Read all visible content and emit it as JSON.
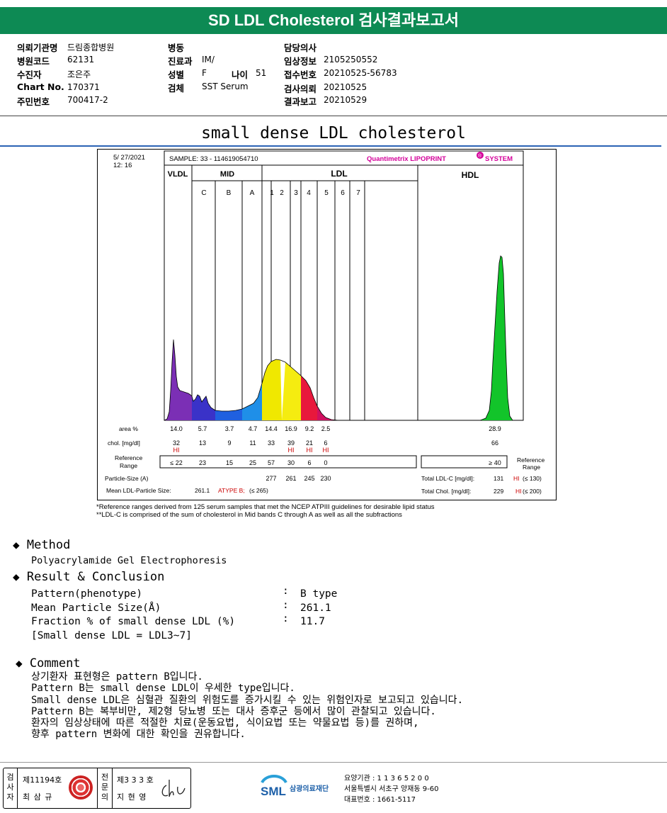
{
  "header": {
    "title": "SD LDL Cholesterol 검사결과보고서"
  },
  "info": {
    "hospital_label": "의뢰기관명",
    "hospital": "드림종합병원",
    "code_label": "병원코드",
    "code": "62131",
    "patient_label": "수진자",
    "patient": "조은주",
    "chart_label": "Chart No.",
    "chart": "170371",
    "id_label": "주민번호",
    "id": "700417-2",
    "ward_label": "병동",
    "ward": "",
    "dept_label": "진료과",
    "dept": "IM/",
    "sex_label": "성별",
    "sex": "F",
    "age_label": "나이",
    "age": "51",
    "specimen_label": "검체",
    "specimen": "SST Serum",
    "doctor_label": "담당의사",
    "doctor": "",
    "clinical_label": "임상정보",
    "clinical": "2105250552",
    "receipt_label": "접수번호",
    "receipt": "20210525-56783",
    "request_label": "검사의뢰",
    "request": "20210525",
    "report_label": "결과보고",
    "report": "20210529"
  },
  "section_title": "small dense LDL cholesterol",
  "chart": {
    "datetime1": "5/ 27/2021",
    "datetime2": "12: 16",
    "sample": "SAMPLE:  33 - 114619054710",
    "brand": "Quantimetrix LIPOPRINT",
    "brand_reg": "®",
    "brand2": "SYSTEM",
    "groups": {
      "vldl": "VLDL",
      "mid": "MID",
      "ldl": "LDL",
      "hdl": "HDL"
    },
    "bands": [
      "C",
      "B",
      "A",
      "1",
      "2",
      "3",
      "4",
      "5",
      "6",
      "7"
    ],
    "row_area_label": "area %",
    "row_chol_label": "chol. [mg/dl]",
    "row_ref_label": "Reference\nRange",
    "ref_right": "Reference\nRange",
    "particle_label": "Particle-Size (A)",
    "mean_label": "Mean LDL-Particle Size:",
    "mean_value": "261.1",
    "mean_flag": "ATYPE B;",
    "mean_ref": "(≤ 265)",
    "total_ldl_label": "Total LDL-C [mg/dl]:",
    "total_ldl": "131",
    "total_ldl_flag": "HI",
    "total_ldl_ref": "(≤ 130)",
    "total_chol_label": "Total Chol. [mg/dl]:",
    "total_chol": "229",
    "total_chol_flag": "HI",
    "total_chol_ref": "(≤ 200)",
    "area": [
      "14.0",
      "5.7",
      "3.7",
      "4.7",
      "14.4",
      "16.9",
      "9.2",
      "2.5",
      "28.9"
    ],
    "chol": [
      "32",
      "13",
      "9",
      "11",
      "33",
      "39",
      "21",
      "6",
      "66"
    ],
    "chol_flags": [
      "HI",
      "",
      "",
      "",
      "",
      "HI",
      "HI",
      "HI",
      ""
    ],
    "ref": [
      "≤ 22",
      "23",
      "15",
      "25",
      "57",
      "30",
      "6",
      "0",
      "≥ 40"
    ],
    "particle": [
      "277",
      "261",
      "245",
      "230"
    ],
    "note1": "*Reference ranges derived from 125 serum samples that met the NCEP ATPIII guidelines for desirable lipid status",
    "note2": "**LDL-C is comprised of the sum of cholesterol in Mid bands C through A as well as all the subfractions"
  },
  "chart_data": {
    "type": "area",
    "title": "small dense LDL cholesterol",
    "xlabel": "",
    "ylabel": "",
    "categories": [
      "VLDL",
      "C",
      "B",
      "A",
      "1",
      "2",
      "3",
      "4",
      "HDL"
    ],
    "series": [
      {
        "name": "area %",
        "values": [
          14.0,
          5.7,
          3.7,
          4.7,
          14.4,
          16.9,
          9.2,
          2.5,
          28.9
        ]
      }
    ]
  },
  "method": {
    "title": "Method",
    "text": "Polyacrylamide Gel Electrophoresis"
  },
  "result": {
    "title": "Result & Conclusion",
    "rows": [
      {
        "label": "Pattern(phenotype)",
        "value": "B type"
      },
      {
        "label": "Mean Particle Size(Å)",
        "value": "261.1"
      },
      {
        "label": "Fraction % of small dense LDL (%)",
        "value": "11.7"
      },
      {
        "label": "[Small dense LDL = LDL3~7]",
        "value": ""
      }
    ]
  },
  "comment": {
    "title": "Comment",
    "lines": [
      "상기환자 표현형은 pattern B입니다.",
      "Pattern B는 small dense LDL이 우세한 type입니다.",
      "Small dense LDL은 심혈관 질환의 위험도를 증가시킬 수 있는 위험인자로 보고되고 있습니다.",
      "Pattern B는 복부비만, 제2형 당뇨병 또는 대사 증후군 등에서 많이 관찰되고 있습니다.",
      "환자의 임상상태에 따른 적절한 치료(운동요법, 식이요법 또는 약물요법 등)를 권하며,",
      "향후 pattern 변화에 대한 확인을 권유합니다."
    ]
  },
  "footer": {
    "examiner_label": "검사자",
    "examiner_no": "제11194호",
    "examiner_name": "최 삼 규",
    "specialist_label": "전문의",
    "specialist_no": "제3 3 3 호",
    "specialist_name": "지 현 영",
    "org_name": "삼광의료재단",
    "org_logo": "SML",
    "org_line1": "요양기관 : 1 1 3 6 5 2 0 0",
    "org_line2": "서울특별시 서초구 양재동 9-60",
    "org_line3": "대표번호 : 1661-5117"
  }
}
